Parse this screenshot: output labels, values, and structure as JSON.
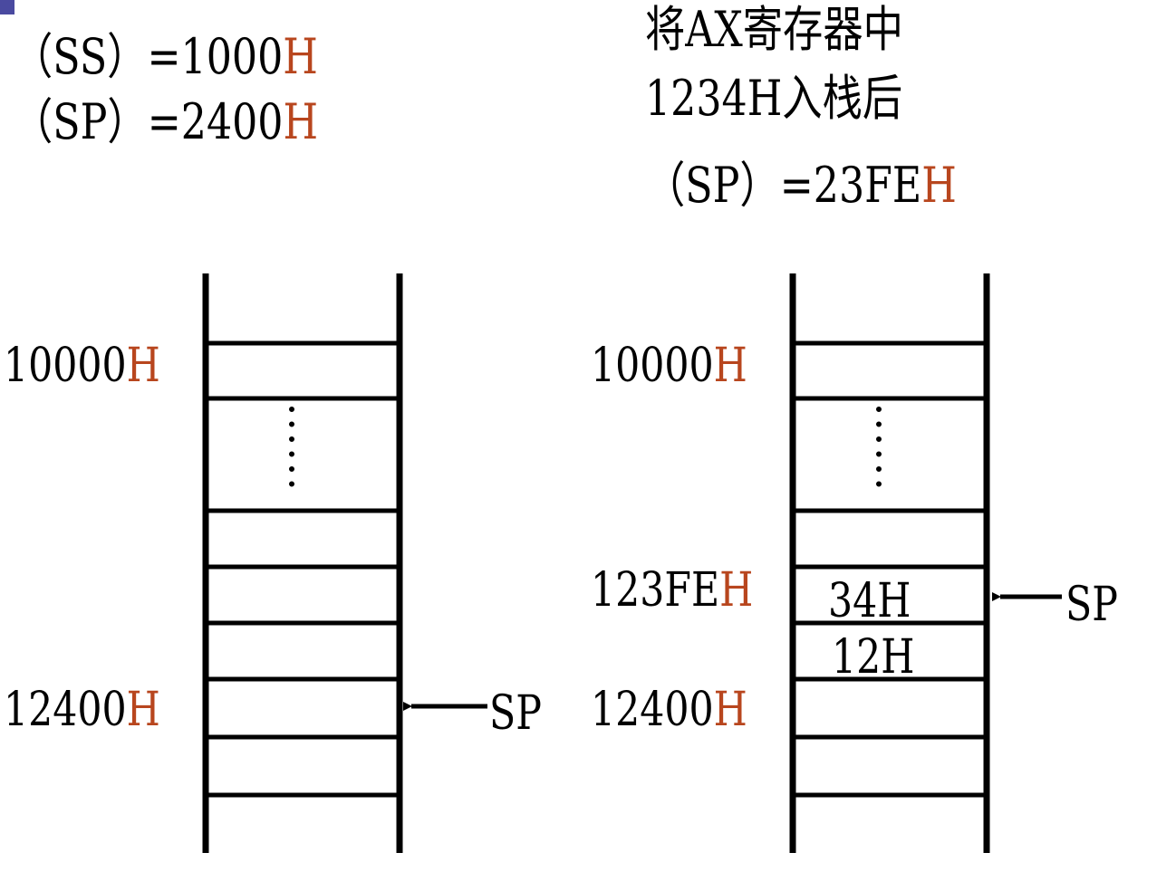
{
  "left": {
    "header_lines": [
      {
        "text": "（SS）=1000",
        "suffix": "H"
      },
      {
        "text": "（SP）=2400",
        "suffix": "H"
      }
    ],
    "addresses": [
      {
        "text": "10000",
        "suffix": "H"
      },
      {
        "text": "12400",
        "suffix": "H"
      }
    ],
    "pointer_label": "SP"
  },
  "right": {
    "title_lines": [
      "将AX寄存器中",
      "1234H入栈后"
    ],
    "header_line": {
      "text": "（SP）=23FE",
      "suffix": "H"
    },
    "addresses": [
      {
        "text": "10000",
        "suffix": "H"
      },
      {
        "text": "123FE",
        "suffix": "H"
      },
      {
        "text": "12400",
        "suffix": "H"
      }
    ],
    "cells": [
      "34H",
      "12H"
    ],
    "pointer_label": "SP"
  },
  "colors": {
    "hex_suffix": "#b8461e",
    "lines": "#000000"
  }
}
